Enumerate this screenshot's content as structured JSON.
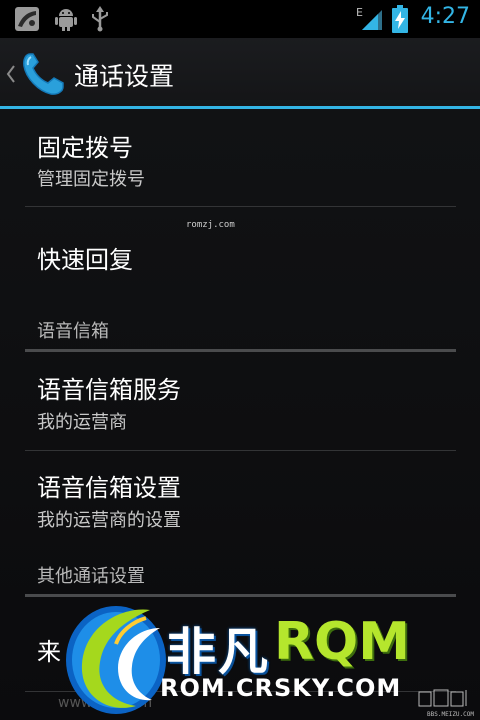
{
  "status_bar": {
    "time": "4:27",
    "network_letter": "E",
    "icons": [
      "image-icon",
      "android-icon",
      "usb-icon",
      "signal-icon",
      "battery-charging-icon"
    ]
  },
  "action_bar": {
    "title": "通话设置",
    "icon": "phone-icon"
  },
  "items": {
    "fdn": {
      "title": "固定拨号",
      "summary": "管理固定拨号"
    },
    "quick_reply": {
      "title": "快速回复"
    },
    "voicemail_service": {
      "title": "语音信箱服务",
      "summary": "我的运营商"
    },
    "voicemail_settings": {
      "title": "语音信箱设置",
      "summary": "我的运营商的设置"
    },
    "incoming": {
      "title": "来"
    }
  },
  "categories": {
    "voicemail": "语音信箱",
    "other": "其他通话设置"
  },
  "watermarks": {
    "romzj": "romzj.com",
    "faded_url": "www.      du.com",
    "logo_cn": "非凡",
    "logo_rom": "RQM",
    "logo_url": "ROM.CRSKY.COM",
    "corner": "BBS.MEIZU.COM"
  },
  "colors": {
    "accent": "#33b5e5",
    "logo_green": "#b5e62d",
    "logo_blue": "#1e7fe0"
  }
}
